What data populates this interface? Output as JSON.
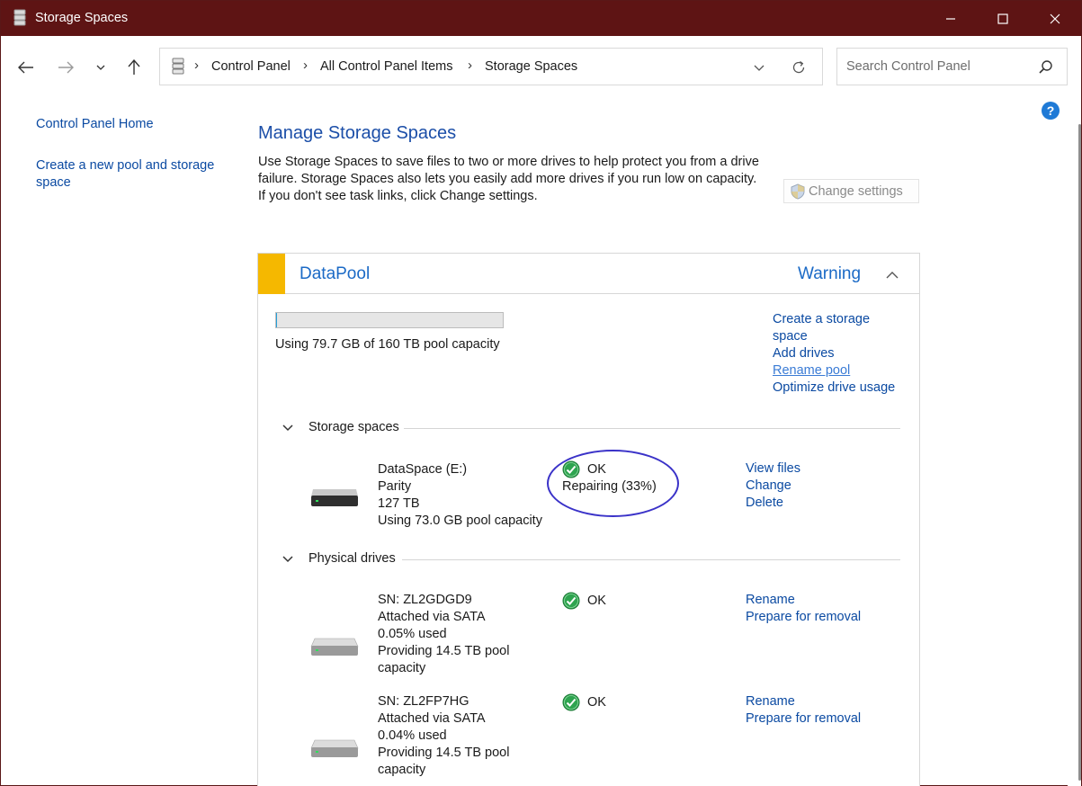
{
  "window": {
    "title": "Storage Spaces",
    "controls": {
      "minimize": "minimize",
      "maximize": "maximize",
      "close": "close"
    }
  },
  "address_bar": {
    "breadcrumbs": [
      "Control Panel",
      "All Control Panel Items",
      "Storage Spaces"
    ]
  },
  "search": {
    "placeholder": "Search Control Panel"
  },
  "left_pane": {
    "links": [
      "Control Panel Home",
      "Create a new pool and storage space"
    ]
  },
  "main": {
    "title": "Manage Storage Spaces",
    "intro": "Use Storage Spaces to save files to two or more drives to help protect you from a drive failure. Storage Spaces also lets you easily add more drives if you run low on capacity. If you don't see task links, click Change settings.",
    "change_settings_label": "Change settings"
  },
  "pool": {
    "name": "DataPool",
    "status": "Warning",
    "capacity_text": "Using 79.7 GB of 160 TB pool capacity",
    "capacity_fraction": 0.0005,
    "actions": {
      "create": "Create a storage space",
      "add_drives": "Add drives",
      "rename": "Rename pool",
      "optimize": "Optimize drive usage"
    },
    "storage_spaces_label": "Storage spaces",
    "physical_drives_label": "Physical drives",
    "storage_spaces": [
      {
        "name": "DataSpace (E:)",
        "type": "Parity",
        "size": "127 TB",
        "usage": "Using 73.0 GB pool capacity",
        "status": "OK",
        "substatus": "Repairing (33%)",
        "actions": [
          "View files",
          "Change",
          "Delete"
        ]
      }
    ],
    "physical_drives": [
      {
        "serial": "SN: ZL2GDGD9",
        "connection": "Attached via SATA",
        "used": "0.05% used",
        "providing_1": "Providing 14.5 TB pool",
        "providing_2": "capacity",
        "status": "OK",
        "actions": [
          "Rename",
          "Prepare for removal"
        ]
      },
      {
        "serial": "SN: ZL2FP7HG",
        "connection": "Attached via SATA",
        "used": "0.04% used",
        "providing_1": "Providing 14.5 TB pool",
        "providing_2": "capacity",
        "status": "OK",
        "actions": [
          "Rename",
          "Prepare for removal"
        ]
      }
    ]
  },
  "help_label": "?",
  "colors": {
    "titlebar": "#5e1414",
    "link": "#0b4aa2",
    "heading": "#1b4ea8",
    "warning_stripe": "#f5b800",
    "ok_green": "#2ea44f",
    "annotation": "#3a32c8"
  }
}
